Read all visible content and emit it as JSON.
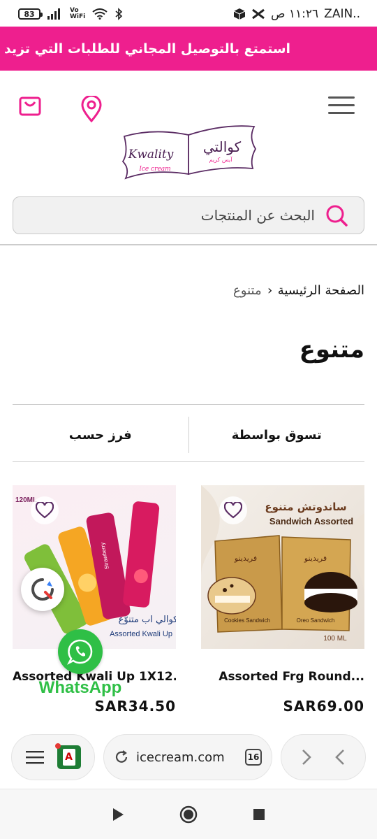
{
  "status_bar": {
    "battery": "83",
    "carrier": "ZAIN..",
    "time": "١١:٢٦ ص",
    "volte_top": "Vo",
    "volte_bottom": "WiFi"
  },
  "promo_banner": {
    "text": "استمتع بالتوصيل المجاني للطلبات التي تزيد"
  },
  "header": {
    "logo_latin": "Kwality",
    "logo_sub": "Ice cream",
    "logo_arabic": "كوالتي",
    "logo_arabic_sub": "آيس كريم",
    "search_placeholder": "البحث عن المنتجات"
  },
  "breadcrumb": {
    "home": "الصفحة الرئيسية",
    "separator": "›",
    "current": "متنوع"
  },
  "page_title": "متنوع",
  "filters": {
    "shop_by": "تسوق بواسطة",
    "sort_by": "فرز حسب"
  },
  "products": [
    {
      "name": "Assorted Frg Round...",
      "price": "SAR69.00",
      "img_title_ar": "ساندوتش متنوع",
      "img_title_en": "Sandwich Assorted",
      "img_brand": "فريدينو",
      "img_volume": "100 ML",
      "pack_left_label": "Cookies Sandwich",
      "pack_right_label": "Oreo Sandwich"
    },
    {
      "name": "Assorted Kwali Up 1X12...",
      "price": "SAR34.50",
      "img_title_ar": "كوالي اب متنوّع",
      "img_title_en": "Assorted Kwali Up",
      "img_volume": "120ML",
      "img_flavor": "Strawberry"
    }
  ],
  "whatsapp": {
    "label": "WhatsApp"
  },
  "browser": {
    "url": "icecream.com",
    "tab_count": "16",
    "app_icon_letter": "A"
  },
  "colors": {
    "brand_pink": "#ee1f8e",
    "whatsapp_green": "#2fbf46"
  }
}
